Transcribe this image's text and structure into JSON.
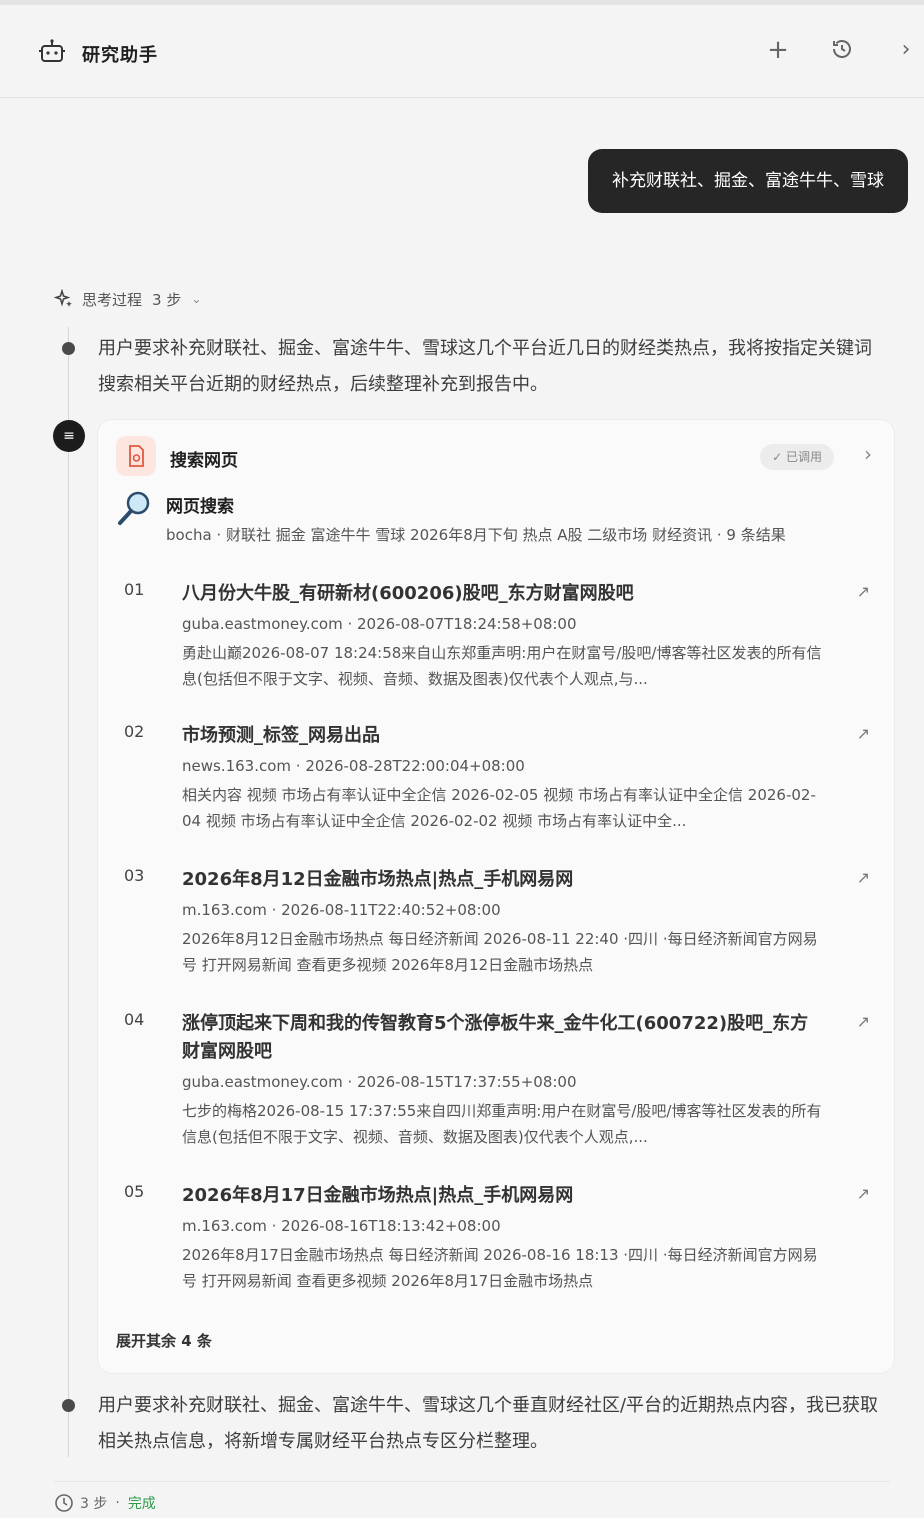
{
  "header": {
    "title": "研究助手",
    "icons": [
      "robot-icon",
      "plus-icon",
      "history-icon",
      "chevron-right-icon"
    ]
  },
  "user_message": "补充财联社、掘金、富途牛牛、雪球",
  "thinking": {
    "label": "思考过程",
    "steps": "3 步",
    "para1": "用户要求补充财联社、掘金、富途牛牛、雪球这几个平台近几日的财经类热点，我将按指定关键词搜索相关平台近期的财经热点，后续整理补充到报告中。",
    "para2": "用户要求补充财联社、掘金、富途牛牛、雪球这几个垂直财经社区/平台的近期热点内容，我已获取相关热点信息，将新增专属财经平台热点专区分栏整理。"
  },
  "tool_card": {
    "title": "搜索网页",
    "status": "已调用",
    "search_title": "网页搜索",
    "search_meta": "bocha · 财联社 掘金 富途牛牛 雪球 2026年8月下旬 热点 A股 二级市场 财经资讯 · 9 条结果",
    "results": [
      {
        "num": "01",
        "title": "八月份大牛股_有研新材(600206)股吧_东方财富网股吧",
        "meta": "guba.eastmoney.com · 2026-08-07T18:24:58+08:00",
        "snippet": "勇赴山巅2026-08-07 18:24:58来自山东郑重声明:用户在财富号/股吧/博客等社区发表的所有信息(包括但不限于文字、视频、音频、数据及图表)仅代表个人观点,与..."
      },
      {
        "num": "02",
        "title": "市场预测_标签_网易出品",
        "meta": "news.163.com · 2026-08-28T22:00:04+08:00",
        "snippet": "相关内容 视频 市场占有率认证中全企信 2026-02-05 视频 市场占有率认证中全企信 2026-02-04 视频 市场占有率认证中全企信 2026-02-02 视频 市场占有率认证中全..."
      },
      {
        "num": "03",
        "title": "2026年8月12日金融市场热点|热点_手机网易网",
        "meta": "m.163.com · 2026-08-11T22:40:52+08:00",
        "snippet": "2026年8月12日金融市场热点 每日经济新闻 2026-08-11 22:40 ·四川 ·每日经济新闻官方网易号 打开网易新闻 查看更多视频 2026年8月12日金融市场热点"
      },
      {
        "num": "04",
        "title": "涨停顶起来下周和我的传智教育5个涨停板牛来_金牛化工(600722)股吧_东方财富网股吧",
        "meta": "guba.eastmoney.com · 2026-08-15T17:37:55+08:00",
        "snippet": "七步的梅格2026-08-15 17:37:55来自四川郑重声明:用户在财富号/股吧/博客等社区发表的所有信息(包括但不限于文字、视频、音频、数据及图表)仅代表个人观点,..."
      },
      {
        "num": "05",
        "title": "2026年8月17日金融市场热点|热点_手机网易网",
        "meta": "m.163.com · 2026-08-16T18:13:42+08:00",
        "snippet": "2026年8月17日金融市场热点 每日经济新闻 2026-08-16 18:13 ·四川 ·每日经济新闻官方网易号 打开网易新闻 查看更多视频 2026年8月17日金融市场热点"
      }
    ],
    "expand": "展开其余 4 条"
  },
  "footer": {
    "steps": "3 步",
    "status": "完成"
  }
}
